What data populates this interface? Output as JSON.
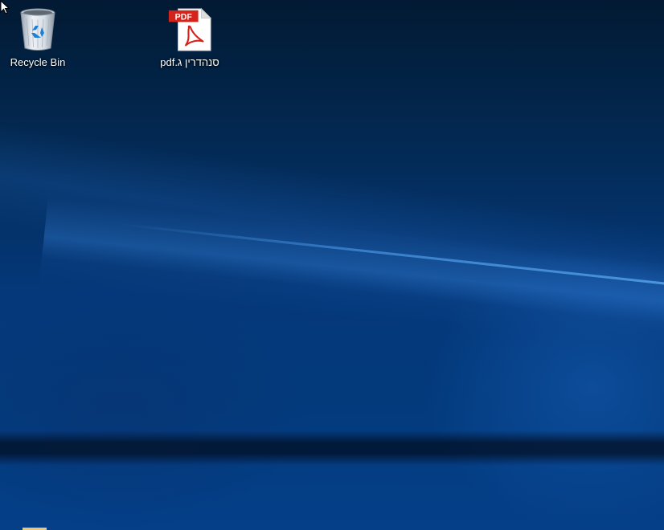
{
  "desktop": {
    "icons": [
      {
        "label": "Recycle Bin",
        "icon": "recycle-bin-icon"
      },
      {
        "label": "סנהדרין ג.pdf",
        "icon": "pdf-file-icon",
        "badge": "PDF"
      }
    ]
  },
  "colors": {
    "wallpaper_dark": "#021a33",
    "wallpaper_mid": "#04387a",
    "pdf_red": "#d3231a",
    "label_text": "#ffffff"
  }
}
